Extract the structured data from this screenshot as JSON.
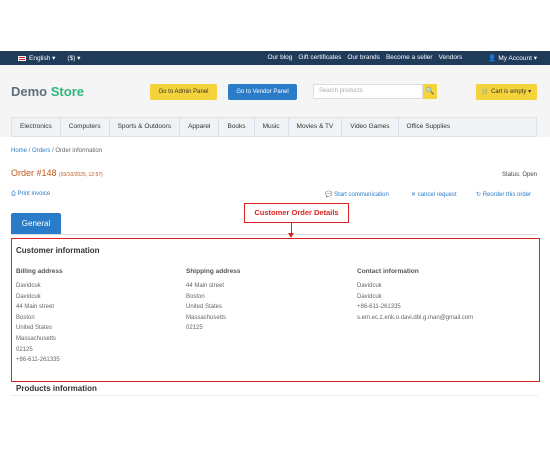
{
  "topbar": {
    "language": "English",
    "currency": "($)",
    "links": [
      "Our blog",
      "Gift certificates",
      "Our brands",
      "Become a seller",
      "Vendors"
    ],
    "account": "My Account"
  },
  "header": {
    "logo_demo": "Demo",
    "logo_store": "Store",
    "admin_panel": "Go to Admin Panel",
    "vendor_panel": "Go to Vendor Panel",
    "search_placeholder": "Search products",
    "cart": "Cart is empty"
  },
  "nav": [
    "Electronics",
    "Computers",
    "Sports & Outdoors",
    "Apparel",
    "Books",
    "Music",
    "Movies & TV",
    "Video Games",
    "Office Supplies"
  ],
  "breadcrumb": {
    "home": "Home",
    "orders": "Orders",
    "current": "Order information"
  },
  "order": {
    "title": "Order #148",
    "date": "(03/10/2025, 12:57)",
    "status": "Status: Open",
    "print": "Print invoice",
    "start_comm": "Start communication",
    "cancel": "cancel request",
    "reorder": "Reorder this order"
  },
  "tab": {
    "general": "General"
  },
  "callout": "Customer Order Details",
  "customer": {
    "title": "Customer information",
    "billing": {
      "heading": "Billing address",
      "lines": [
        "Davidcuk",
        "Davidcuk",
        "44 Main street",
        "Boston",
        "United States",
        "Massachusetts",
        "02125",
        "+86-611-261335"
      ]
    },
    "shipping": {
      "heading": "Shipping address",
      "lines": [
        "44 Main street",
        "Boston",
        "United States",
        "Massachusetts",
        "02125"
      ]
    },
    "contact": {
      "heading": "Contact information",
      "lines": [
        "Davidcuk",
        "Davidcuk",
        "+86-611-261335",
        "s.em.ec.z.enk.o.davi.dbi.g.man@gmail.com"
      ]
    }
  },
  "products": {
    "title": "Products information"
  }
}
